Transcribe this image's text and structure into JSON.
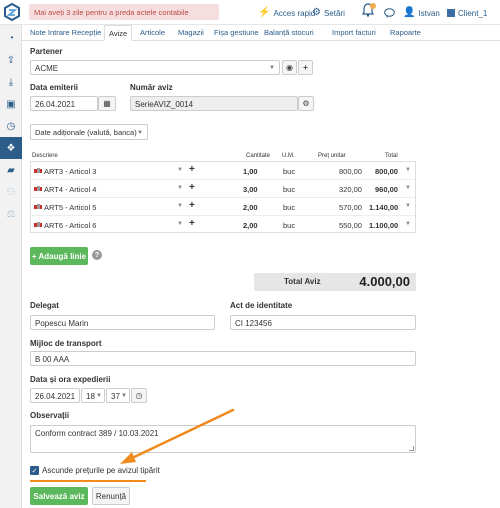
{
  "topbar": {
    "notice": "Mai aveți 3 zile pentru a preda actele contabile",
    "quick_access": "Acces rapid",
    "settings": "Setări",
    "user": "Istvan",
    "client": "Client_1"
  },
  "tabs": [
    {
      "label": "Note Intrare Recepție"
    },
    {
      "label": "Avize"
    },
    {
      "label": "Articole"
    },
    {
      "label": "Magazii"
    },
    {
      "label": "Fișa gestiune"
    },
    {
      "label": "Balanță stocuri"
    },
    {
      "label": "Import facturi"
    },
    {
      "label": "Rapoarte"
    }
  ],
  "active_tab": "Avize",
  "form": {
    "partner_label": "Partener",
    "partner_value": "ACME",
    "issue_date_label": "Data emiterii",
    "issue_date_value": "26.04.2021",
    "notice_number_label": "Număr aviz",
    "notice_number_value": "SerieAVIZ_0014",
    "additional_data_button": "Date adiționale (valută, banca)"
  },
  "table": {
    "headers": {
      "description": "Descriere",
      "quantity": "Cantitate",
      "unit": "U.M.",
      "unit_price": "Preț unitar",
      "total": "Total"
    },
    "rows": [
      {
        "description": "ART3 - Articol 3",
        "quantity": "1,00",
        "unit": "buc",
        "unit_price": "800,00",
        "total": "800,00"
      },
      {
        "description": "ART4 - Articol 4",
        "quantity": "3,00",
        "unit": "buc",
        "unit_price": "320,00",
        "total": "960,00"
      },
      {
        "description": "ART5 - Articol 5",
        "quantity": "2,00",
        "unit": "buc",
        "unit_price": "570,00",
        "total": "1.140,00"
      },
      {
        "description": "ART6 - Articol 6",
        "quantity": "2,00",
        "unit": "buc",
        "unit_price": "550,00",
        "total": "1.100,00"
      }
    ],
    "add_line_button": "+ Adaugă linie"
  },
  "total": {
    "label": "Total Aviz",
    "value": "4.000,00"
  },
  "delegate": {
    "label": "Delegat",
    "value": "Popescu Marin"
  },
  "id_act": {
    "label": "Act de identitate",
    "value": "CI 123456"
  },
  "transport": {
    "label": "Mijloc de transport",
    "value": "B 00 AAA"
  },
  "dispatch": {
    "label": "Data și ora expedierii",
    "date": "26.04.2021",
    "hour": "18",
    "minute": "37"
  },
  "observations": {
    "label": "Observații",
    "value": "Conform contract 389 / 10.03.2021"
  },
  "hide_prices": {
    "label": "Ascunde prețurile pe avizul tipărit",
    "checked": true
  },
  "actions": {
    "save": "Salvează aviz",
    "cancel": "Renunță"
  },
  "colors": {
    "accent": "#2b5c8a",
    "green": "#5cb85c",
    "arrow": "#f08a1c",
    "notice_bg": "#f6dede"
  }
}
